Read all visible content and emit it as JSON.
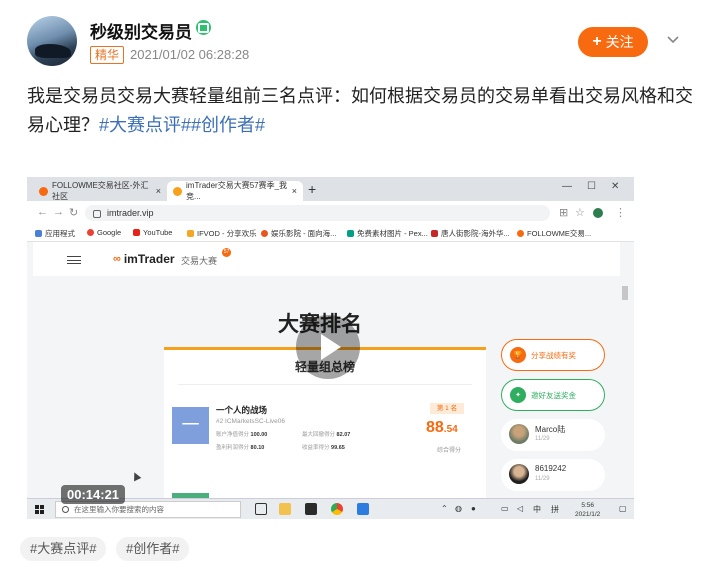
{
  "author": {
    "name": "秒级别交易员",
    "badge": "精华",
    "time": "2021/01/02 06:28:28"
  },
  "actions": {
    "follow_label": "关注"
  },
  "post": {
    "text": "我是交易员交易大赛轻量组前三名点评：如何根据交易员的交易单看出交易风格和交易心理？",
    "tags_inline": "#大赛点评##创作者#"
  },
  "video": {
    "duration": "00:14:21",
    "browser": {
      "tabs": [
        {
          "label": "FOLLOWME交易社区-外汇社区",
          "close": "×"
        },
        {
          "label": "imTrader交易大赛57赛季_我竞...",
          "close": "×"
        }
      ],
      "new_tab": "+",
      "url": "imtrader.vip",
      "bookmarks": [
        "应用程式",
        "Google",
        "YouTube",
        "IFVOD - 分享欢乐",
        "娱乐影院 - 面向海...",
        "免费素材图片 - Pex...",
        "唐人街影院-海外华...",
        "FOLLOWME交易..."
      ]
    },
    "site": {
      "logo": "imTrader",
      "logo_sub": "交易大赛",
      "logo_badge": "57",
      "rank_title": "大赛排名",
      "board_title": "轻量组总榜",
      "entry": {
        "avatar_char": "一",
        "name": "一个人的战场",
        "rank_line": "#2  ICMarketsSC-Live06",
        "place": "第 1 名",
        "score_int": "88",
        "score_dec": ".54",
        "score_label": "综合得分",
        "stats": [
          {
            "label": "账户净值得分",
            "value": "100.00"
          },
          {
            "label": "最大回撤得分",
            "value": "82.07"
          },
          {
            "label": "盈利利润得分",
            "value": "80.10"
          },
          {
            "label": "收益率得分",
            "value": "99.65"
          }
        ]
      },
      "side_buttons": [
        "分享战绩有奖",
        "邀好友送奖金"
      ],
      "users": [
        {
          "name": "Marco陆",
          "date": "11/29"
        },
        {
          "name": "8619242",
          "date": "11/29"
        }
      ]
    },
    "taskbar": {
      "search_placeholder": "在这里输入你要搜索的内容",
      "tray_ime": "中",
      "tray_lang": "拼",
      "clock_time": "5:56",
      "clock_date": "2021/1/2"
    }
  },
  "tags": [
    "#大赛点评#",
    "#创作者#"
  ],
  "colors": {
    "accent": "#f76a10",
    "link": "#3d6fb6",
    "verified": "#2fbf71"
  }
}
